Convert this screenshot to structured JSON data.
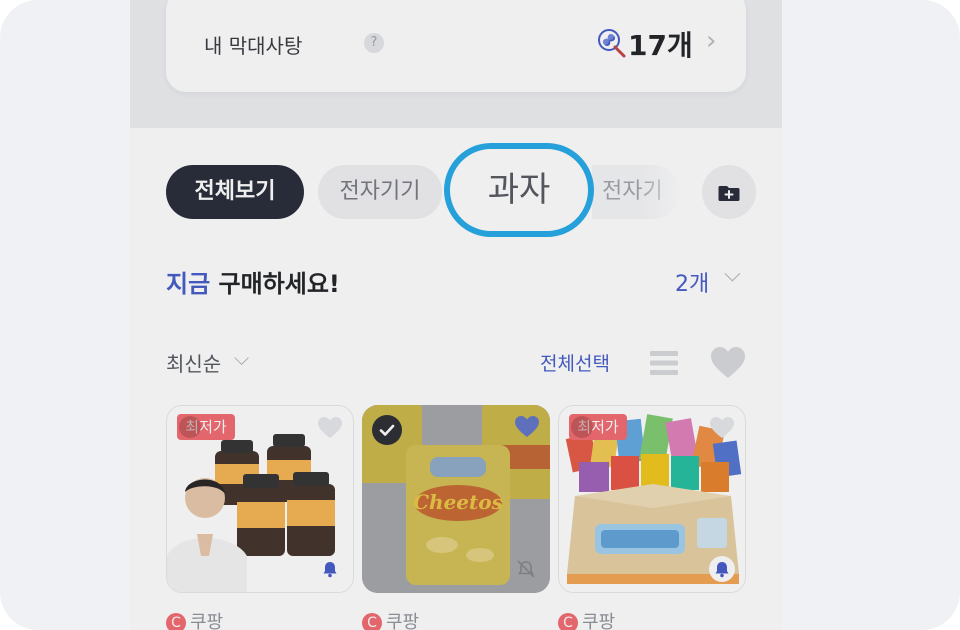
{
  "lollipop": {
    "label": "내 막대사탕",
    "help": "?",
    "count": "17개",
    "chevron": "›"
  },
  "filters": {
    "all": "전체보기",
    "electronics_1": "전자기기",
    "snack": "과자",
    "electronics_2": "전자기",
    "add_icon": "folder-plus-icon"
  },
  "buy_now": {
    "highlight": "지금",
    "rest": " 구매하세요!",
    "count": "2개"
  },
  "sort": {
    "label": "최신순",
    "select_all": "전체선택"
  },
  "products": [
    {
      "badge": "최저가",
      "shop": "쿠팡",
      "checked": false,
      "image": "supplement-bottles"
    },
    {
      "badge": "",
      "shop": "쿠팡",
      "checked": true,
      "image": "cheetos-bags"
    },
    {
      "badge": "최저가",
      "shop": "쿠팡",
      "checked": false,
      "image": "snack-box"
    }
  ],
  "colors": {
    "accent": "#3d55c8",
    "highlight_ring": "#1aa6e8",
    "dark_chip": "#1d2130",
    "badge": "#f1646a"
  }
}
